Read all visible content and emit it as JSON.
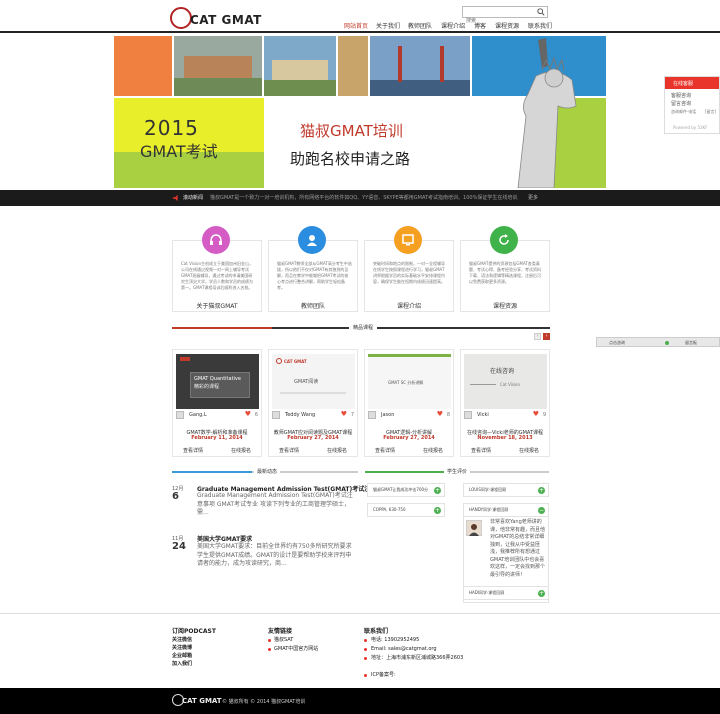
{
  "header": {
    "logo_text": "CAT GMAT",
    "search_placeholder": "搜索",
    "nav": [
      "网站首页",
      "关于我们",
      "教师团队",
      "课程介绍",
      "博客",
      "课程资源",
      "联系我们"
    ]
  },
  "banner": {
    "year": "2015",
    "exam": "GMAT考试",
    "title": "猫叔GMAT培训",
    "subtitle": "助跑名校申请之路"
  },
  "ticker": {
    "label": "滚动新闻",
    "text": "猫叔GMAT是一个致力一对一培训机构，所有网络平台的软件如QQ、YY语音、SKYPE等都用GMAT考试指南培训。100%保证学生在线培训质量和高效用，",
    "more": "更多"
  },
  "chat": {
    "title": "在线客服",
    "items": [
      "客服咨询",
      "留言咨询",
      "咨询邮件·电话"
    ],
    "extra": "[留言]",
    "powered": "Powered by 53KF"
  },
  "consult": {
    "left": "点击咨询",
    "right": "留言板"
  },
  "features": [
    {
      "label": "关于猫叔GMAT",
      "text": "Cat Vision主创成立于美国加州旧金山，公司在线通过视频一对一网上辅导考试GMAT班级辅导，通过考试的申请美国研究生顶尖大学，学员人数和学员的成绩为第一。GMAT课程培训后顺利进入名校。"
    },
    {
      "label": "教师团队",
      "text": "猫叔GMAT教师全部从GMAT高分考生中选拔，所以他们不仅对GMAT有其独到的见解，而且在教学中能够把GMAT考试的核心考点进行整合讲解，帮助学生轻松备考。"
    },
    {
      "label": "课程介绍",
      "text": "突破时间和地点的限制，一对一全程辅导在线学生按照课程进行学习，猫叔GMAT讲师根据学员的实际基础水平安排课程内容，确保学生能在短期内成绩迅速提高。"
    },
    {
      "label": "课程资源",
      "text": "猫叔GMAT提供的资源包括GMAT各类真题、考试心得、备考经验分享、考试资料下载、语法和逻辑等精选课程。注册后可以免费获取更多资源。"
    }
  ],
  "courses_title": "精品课程",
  "courses": [
    {
      "author": "Gang.L",
      "count": "6",
      "title": "GMAT数学-解析和准备课程",
      "date": "February 11, 2014",
      "thumb_head": "GMAT Quantitative",
      "thumb_sub": "精彩的课程"
    },
    {
      "author": "Teddy Wang",
      "count": "7",
      "title": "教师GMAT应对阅读题及GMAT课程",
      "date": "February 27, 2014",
      "thumb_head": "CAT GMAT",
      "thumb_sub": "GMAT阅读"
    },
    {
      "author": "Jason",
      "count": "8",
      "title": "GMAT逻辑-分析讲解",
      "date": "February 27, 2014",
      "thumb_head": "GMAT SC 分析讲解",
      "thumb_sub": ""
    },
    {
      "author": "Vicki",
      "count": "9",
      "title": "在线咨询—Vicki老师的GMAT课程",
      "date": "November 18, 2013",
      "thumb_head": "在线咨询",
      "thumb_sub": "Cat Vision"
    }
  ],
  "course_actions": {
    "details": "查看详情",
    "enroll": "在线报名"
  },
  "news_title": "最新动态",
  "news": [
    {
      "month": "12月",
      "day": "6",
      "title": "Graduate Management Admission Test(GMAT)考试注意事项",
      "body": "Graduate Management Admission Test(GMAT)考试注意事项 GMAT考试专业 攻读下列专业的工商管理学硕士，需..."
    },
    {
      "month": "11月",
      "day": "24",
      "title": "美国大学GMAT要求",
      "body": "美国大学GMAT要求：目前全世界约有750多所研究所要求学生提供GMAT成绩。GMAT的设计是要帮助学校来评判申请者的能力，成为攻读研究，商..."
    }
  ],
  "reviews_title": "学生评价",
  "reviews": [
    "猫叔GMAT让我成功冲击700分",
    "LOUIS同学·课程回顾",
    "COPPA, 630-750",
    "HANDY同学·课程回顾"
  ],
  "review_quote": "非常喜欢Yang老师讲的课，他非常有趣，而且他对GMAT的总结非常详细独到，让我从中受益匪浅，我推荐所有想通过GMAT培训团队中也会喜欢这样，一定会找到那个最引导的讲师！",
  "review_last": "HADI同学·课程回顾",
  "footer": {
    "podcast_title": "订阅PODCAST",
    "podcast_links": [
      "关注微信",
      "关注微博",
      "企业邮箱",
      "加入我们"
    ],
    "links_title": "友情链接",
    "links": [
      "猫叔SAT",
      "GMAT中国官方网站"
    ],
    "contact_title": "联系我们",
    "contact": [
      "电话: 13902952495",
      "Email: sales@catgmat.org",
      "地址：上海市浦东新区浦城路366弄2603",
      "ICP备案号:"
    ],
    "copyright": "© 猫叔所有 © 2014 猫叔GMAT培训"
  }
}
